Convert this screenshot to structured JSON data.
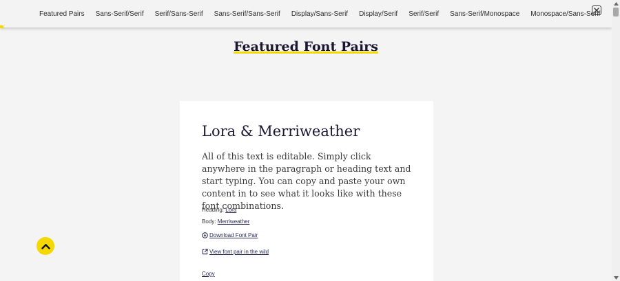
{
  "nav": {
    "items": [
      "Featured Pairs",
      "Sans-Serif/Serif",
      "Serif/Sans-Serif",
      "Sans-Serif/Sans-Serif",
      "Display/Sans-Serif",
      "Display/Serif",
      "Serif/Serif",
      "Sans-Serif/Monospace",
      "Monospace/Sans-Serif"
    ],
    "accent_color": "#f5d800"
  },
  "page": {
    "title": "Featured Font Pairs"
  },
  "card": {
    "title": "Lora & Merriweather",
    "body": "All of this text is editable. Simply click anywhere in the paragraph or heading text and start typing. You can copy and paste your own content in to see what it looks like with these font combinations.",
    "heading_label": "Heading:",
    "heading_font": "Lora",
    "body_label": "Body:",
    "body_font": "Merriweather",
    "download_label": "Download Font Pair",
    "view_label": "View font pair in the wild",
    "copy_label": "Copy"
  },
  "icons": {
    "close": "close-icon",
    "download": "download-icon",
    "external_link": "external-link-icon",
    "back_to_top": "chevron-up-icon"
  }
}
